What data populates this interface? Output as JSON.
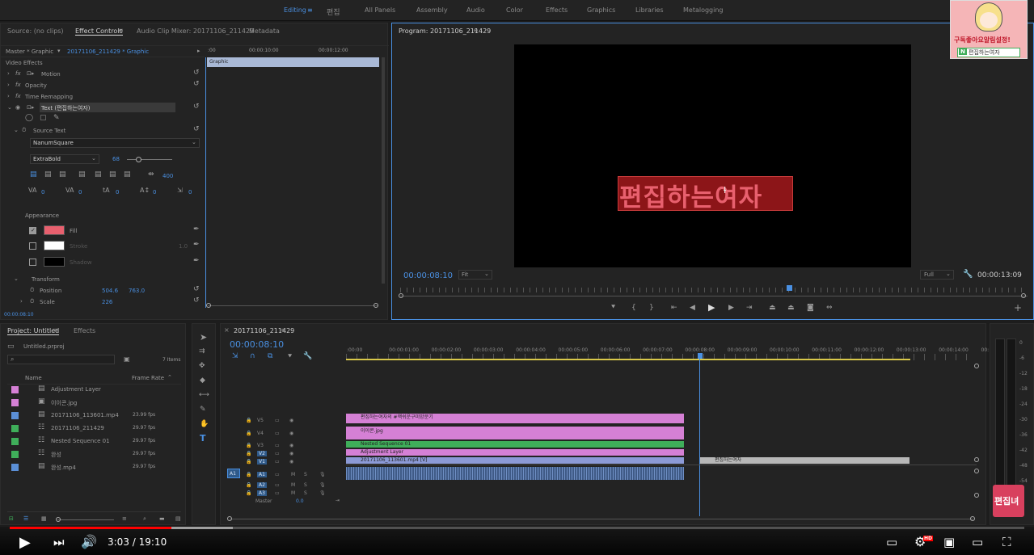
{
  "workspace": {
    "items": [
      "Editing",
      "편집",
      "All Panels",
      "Assembly",
      "Audio",
      "Color",
      "Effects",
      "Graphics",
      "Libraries",
      "Metalogging"
    ],
    "active": "Editing"
  },
  "source_panel": {
    "tabs": [
      "Source: (no clips)",
      "Effect Controls",
      "Audio Clip Mixer: 20171106_211429",
      "Metadata"
    ],
    "master_label": "Master * Graphic",
    "sequence_label": "20171106_211429 * Graphic",
    "time_ticks": [
      ":00",
      "00:00:10:00",
      "00:00:12:00"
    ],
    "graphic_bar": "Graphic",
    "section_video_effects": "Video Effects",
    "effects": [
      "Motion",
      "Opacity",
      "Time Remapping"
    ],
    "text_layer": "Text (편집하는여자)",
    "source_text": "Source Text",
    "font": "NanumSquare",
    "font_style": "ExtraBold",
    "font_size": "68",
    "tracking": "400",
    "kerning_vals": [
      "0",
      "0",
      "0",
      "0",
      "0"
    ],
    "appearance": "Appearance",
    "fill": "Fill",
    "stroke": "Stroke",
    "stroke_val": "1.0",
    "shadow": "Shadow",
    "transform": "Transform",
    "position_label": "Position",
    "position_x": "504.6",
    "position_y": "763.0",
    "scale_label": "Scale",
    "scale_val": "226",
    "timecode": "00:00:08:10",
    "fill_color": "#e8606e"
  },
  "program_monitor": {
    "title": "Program: 20171106_211429",
    "overlay_text": "편집하는여자",
    "timecode": "00:00:08:10",
    "fit": "Fit",
    "quality": "Full",
    "duration": "00:00:13:09"
  },
  "project_panel": {
    "tabs": [
      "Project: Untitled",
      "Effects"
    ],
    "file": "Untitled.prproj",
    "item_count": "7 Items",
    "col_name": "Name",
    "col_frame_rate": "Frame Rate",
    "items": [
      {
        "name": "Adjustment Layer",
        "rate": "",
        "color": "#d580d5"
      },
      {
        "name": "이이콘.jpg",
        "rate": "",
        "color": "#d580d5"
      },
      {
        "name": "20171106_113601.mp4",
        "rate": "23.99 fps",
        "color": "#5b8fd6"
      },
      {
        "name": "20171106_211429",
        "rate": "29.97 fps",
        "color": "#3fae5a"
      },
      {
        "name": "Nested Sequence 01",
        "rate": "29.97 fps",
        "color": "#3fae5a"
      },
      {
        "name": "완성",
        "rate": "29.97 fps",
        "color": "#3fae5a"
      },
      {
        "name": "완성.mp4",
        "rate": "29.97 fps",
        "color": "#5b8fd6"
      }
    ]
  },
  "timeline": {
    "tab": "20171106_211429",
    "timecode": "00:00:08:10",
    "ticks": [
      ":00:00",
      "00:00:01:00",
      "00:00:02:00",
      "00:00:03:00",
      "00:00:04:00",
      "00:00:05:00",
      "00:00:06:00",
      "00:00:07:00",
      "00:00:08:00",
      "00:00:09:00",
      "00:00:10:00",
      "00:00:11:00",
      "00:00:12:00",
      "00:00:13:00",
      "00:00:14:00",
      "00:"
    ],
    "tracks": [
      "V5",
      "V4",
      "V3",
      "V2",
      "V1",
      "A1",
      "A2",
      "A3"
    ],
    "master": "Master",
    "master_val": "0.0",
    "clips": {
      "v5": "편집하는여자의 #핵쉬운구미망문기",
      "v4": "이이콘.jpg",
      "v3": "Nested Sequence 01",
      "v2": "Adjustment Layer",
      "v1": "20171106_113601.mp4 [V]",
      "v1b": "편집하는여자"
    }
  },
  "audio_meter": {
    "labels": [
      "0",
      "-6",
      "-12",
      "-18",
      "-24",
      "-30",
      "-36",
      "-42",
      "-48",
      "-54"
    ]
  },
  "youtube": {
    "time": "3:03 / 19:10",
    "progress": 0.159,
    "buffered": 0.22
  },
  "channel": {
    "avatar_text": "구독좋아요알림설정!",
    "avatar_sub": "편집하는여자",
    "watermark": "편집녀"
  }
}
